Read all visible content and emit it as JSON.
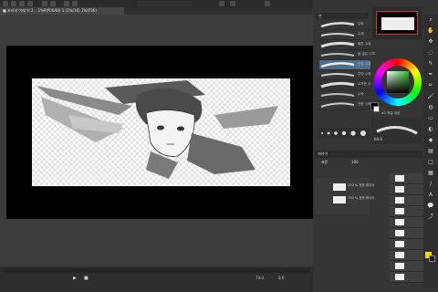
{
  "tab": {
    "title": "■ 꼬리비 어깨 어 2 .. 1%P(P06AB) 1 (1%(16) 1%(P36)"
  },
  "toolbar": {
    "icons": [
      "menu-icon",
      "save-icon",
      "undo-icon",
      "redo-icon",
      "pen-icon",
      "eraser-icon",
      "select-icon",
      "fill-icon"
    ]
  },
  "brush_panel": {
    "title": "붓",
    "items": [
      {
        "label": "유화"
      },
      {
        "label": "수채"
      },
      {
        "label": "빠른 수채"
      },
      {
        "label": "물 많은 수채"
      },
      {
        "label": "번짐 수채"
      },
      {
        "label": "투명 수채"
      },
      {
        "label": "두꺼운 수채"
      },
      {
        "label": "수묵"
      },
      {
        "label": "연한 수묵"
      }
    ],
    "size_value": "64.0"
  },
  "navigator": {
    "label": "내비게이터"
  },
  "color_panel": {
    "label": "컬러 서클",
    "hex_label": "#1 하늘 세상"
  },
  "layer_panel": {
    "title": "레이어",
    "blend": "표준",
    "opacity": "100",
    "layers": [
      {
        "name": "100 % 표준 레이어"
      },
      {
        "name": "100 % 표준 레이어"
      },
      {
        "name": "100 % 표준"
      },
      {
        "name": "100 % 표준"
      },
      {
        "name": "용지"
      }
    ]
  },
  "bottom": {
    "zoom": "74.0",
    "angle": "0.0",
    "frames": "2/10"
  },
  "accent": "#ffd800",
  "bg_dark": "#2b2b2b"
}
